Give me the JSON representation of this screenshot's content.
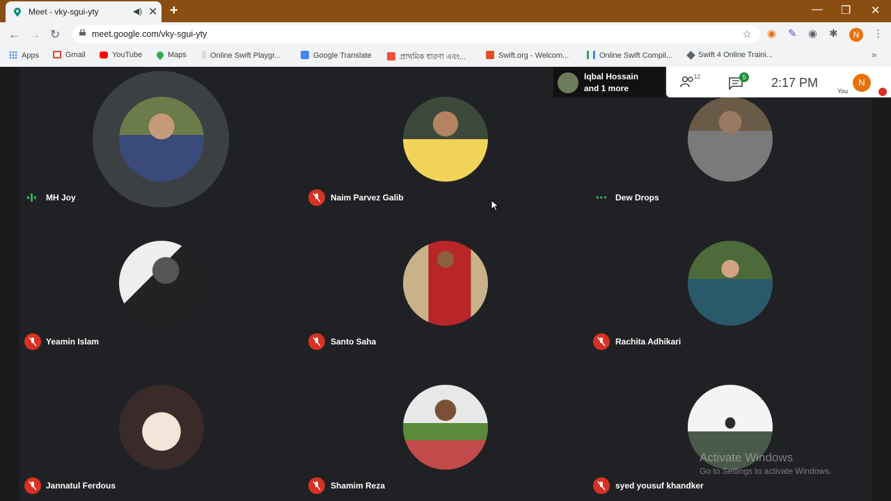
{
  "browser": {
    "tab_title": "Meet - vky-sgui-yty",
    "url": "meet.google.com/vky-sgui-yty",
    "profile_initial": "N",
    "bookmarks": [
      "Apps",
      "Gmail",
      "YouTube",
      "Maps",
      "Online Swift Playgr...",
      "Google Translate",
      "প্রাথমিক ধারণা এবং...",
      "Swift.org - Welcom...",
      "Online Swift Compil...",
      "Swift 4 Online Traini..."
    ]
  },
  "meet": {
    "presenter_line1": "Iqbal Hossain",
    "presenter_line2": "and 1 more",
    "people_count": "12",
    "chat_count": "5",
    "time": "2:17 PM",
    "you_label": "You",
    "you_initial": "N",
    "participants": [
      {
        "name": "MH Joy",
        "status": "speaking"
      },
      {
        "name": "Naim Parvez Galib",
        "status": "muted"
      },
      {
        "name": "Dew Drops",
        "status": "connecting"
      },
      {
        "name": "Yeamin Islam",
        "status": "muted"
      },
      {
        "name": "Santo Saha",
        "status": "muted"
      },
      {
        "name": "Rachita Adhikari",
        "status": "muted"
      },
      {
        "name": "Jannatul Ferdous",
        "status": "muted"
      },
      {
        "name": "Shamim Reza",
        "status": "muted"
      },
      {
        "name": "syed yousuf khandker",
        "status": "muted"
      }
    ]
  },
  "watermark": {
    "line1": "Activate Windows",
    "line2": "Go to Settings to activate Windows."
  },
  "colors": {
    "accent_red": "#d93025",
    "accent_green": "#34a853",
    "bg": "#202124",
    "titlebar": "#8a4d12"
  }
}
